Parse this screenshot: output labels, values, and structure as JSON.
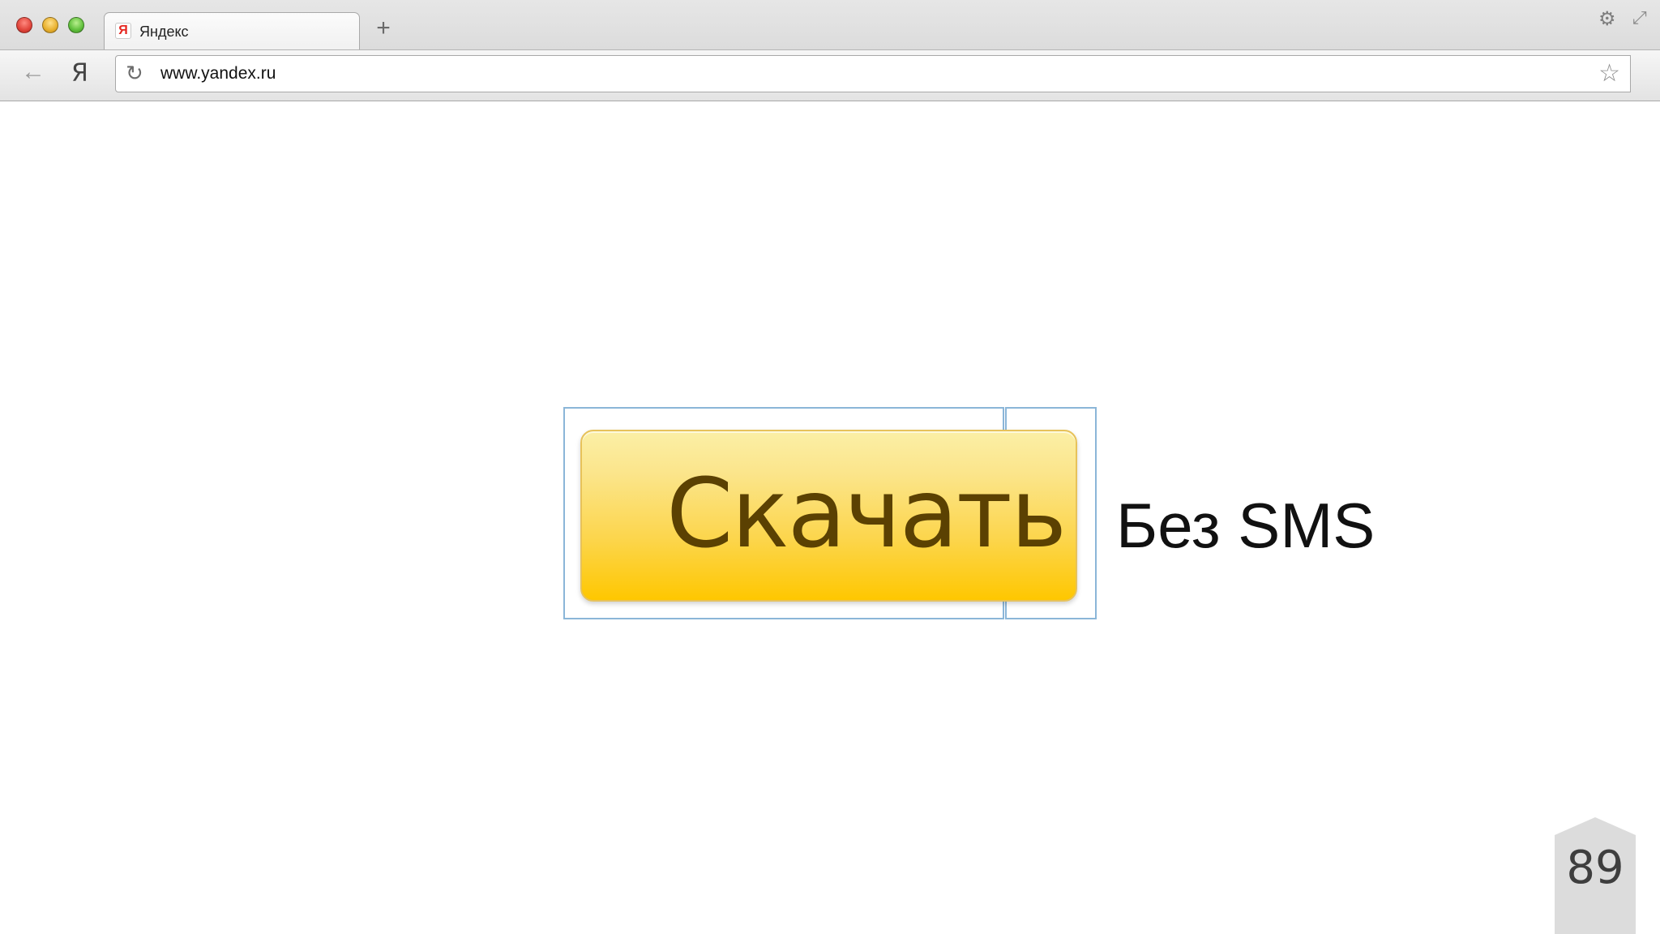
{
  "browser": {
    "tab": {
      "favicon": "Я",
      "title": "Яндекс"
    },
    "new_tab_icon": "+",
    "settings_icon": "gear-icon",
    "fullscreen_icon": "fullscreen-icon",
    "toolbar": {
      "back_icon": "←",
      "yandex_logo": "Я",
      "reload_icon": "↻",
      "url": "www.yandex.ru",
      "bookmark_icon": "☆"
    }
  },
  "slide": {
    "button_label": "Скачать",
    "side_text": "Без SMS",
    "page_number": "89"
  },
  "colors": {
    "button_top": "#fbefa6",
    "button_bottom": "#fec700",
    "button_text": "#5b4102",
    "guide_lines": "#8bb6d8"
  }
}
